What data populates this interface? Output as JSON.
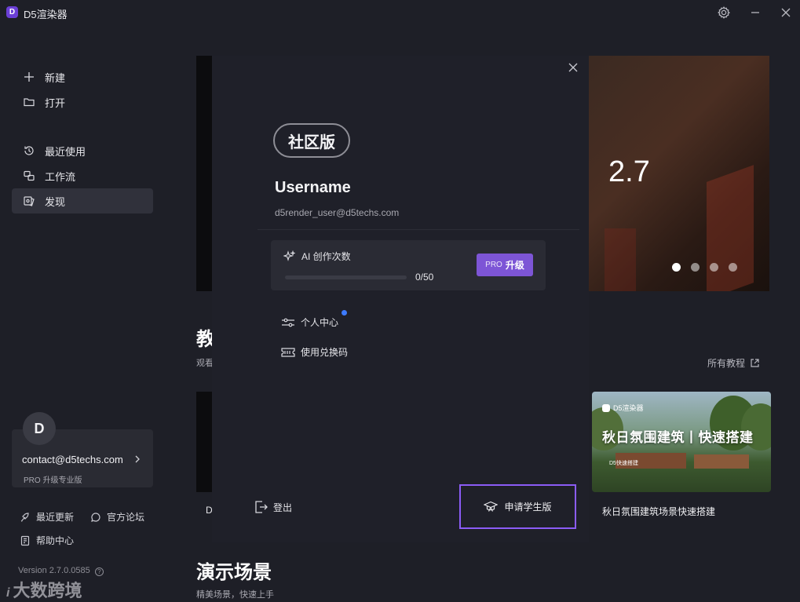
{
  "titlebar": {
    "app_title": "D5渲染器",
    "logo_letter": "D"
  },
  "sidebar": {
    "new_label": "新建",
    "open_label": "打开",
    "recent_label": "最近使用",
    "workflow_label": "工作流",
    "discover_label": "发现"
  },
  "user_card": {
    "avatar_letter": "D",
    "email": "contact@d5techs.com",
    "pro_hint": "PRO 升级专业版"
  },
  "footer": {
    "updates_label": "最近更新",
    "forum_label": "官方论坛",
    "help_label": "帮助中心",
    "version": "Version 2.7.0.0585",
    "watermark": "大数跨境"
  },
  "main": {
    "banner_version": "2.7",
    "carousel": {
      "count": 4,
      "active": 0
    },
    "tutorials_title": "教",
    "tutorials_sub": "观看",
    "all_tutorials": "所有教程",
    "card_letter": "D",
    "tutorial_card": {
      "brand": "D5渲染器",
      "overlay_title": "秋日氛围建筑丨快速搭建",
      "tag": "D5快速搭建",
      "caption": "秋日氛围建筑场景快速搭建"
    },
    "demo_title": "演示场景",
    "demo_sub": "精美场景，快速上手"
  },
  "panel": {
    "edition": "社区版",
    "username": "Username",
    "email": "d5render_user@d5techs.com",
    "ai_label": "AI 创作次数",
    "ai_used": 0,
    "ai_total": 50,
    "ai_count": "0/50",
    "upgrade_pro": "PRO",
    "upgrade_label": "升级",
    "profile_label": "个人中心",
    "redeem_label": "使用兑换码",
    "logout_label": "登出",
    "student_label": "申请学生版"
  },
  "colors": {
    "accent": "#7d55d6",
    "highlight_border": "#8b5cf6",
    "notice": "#3d7bff"
  }
}
